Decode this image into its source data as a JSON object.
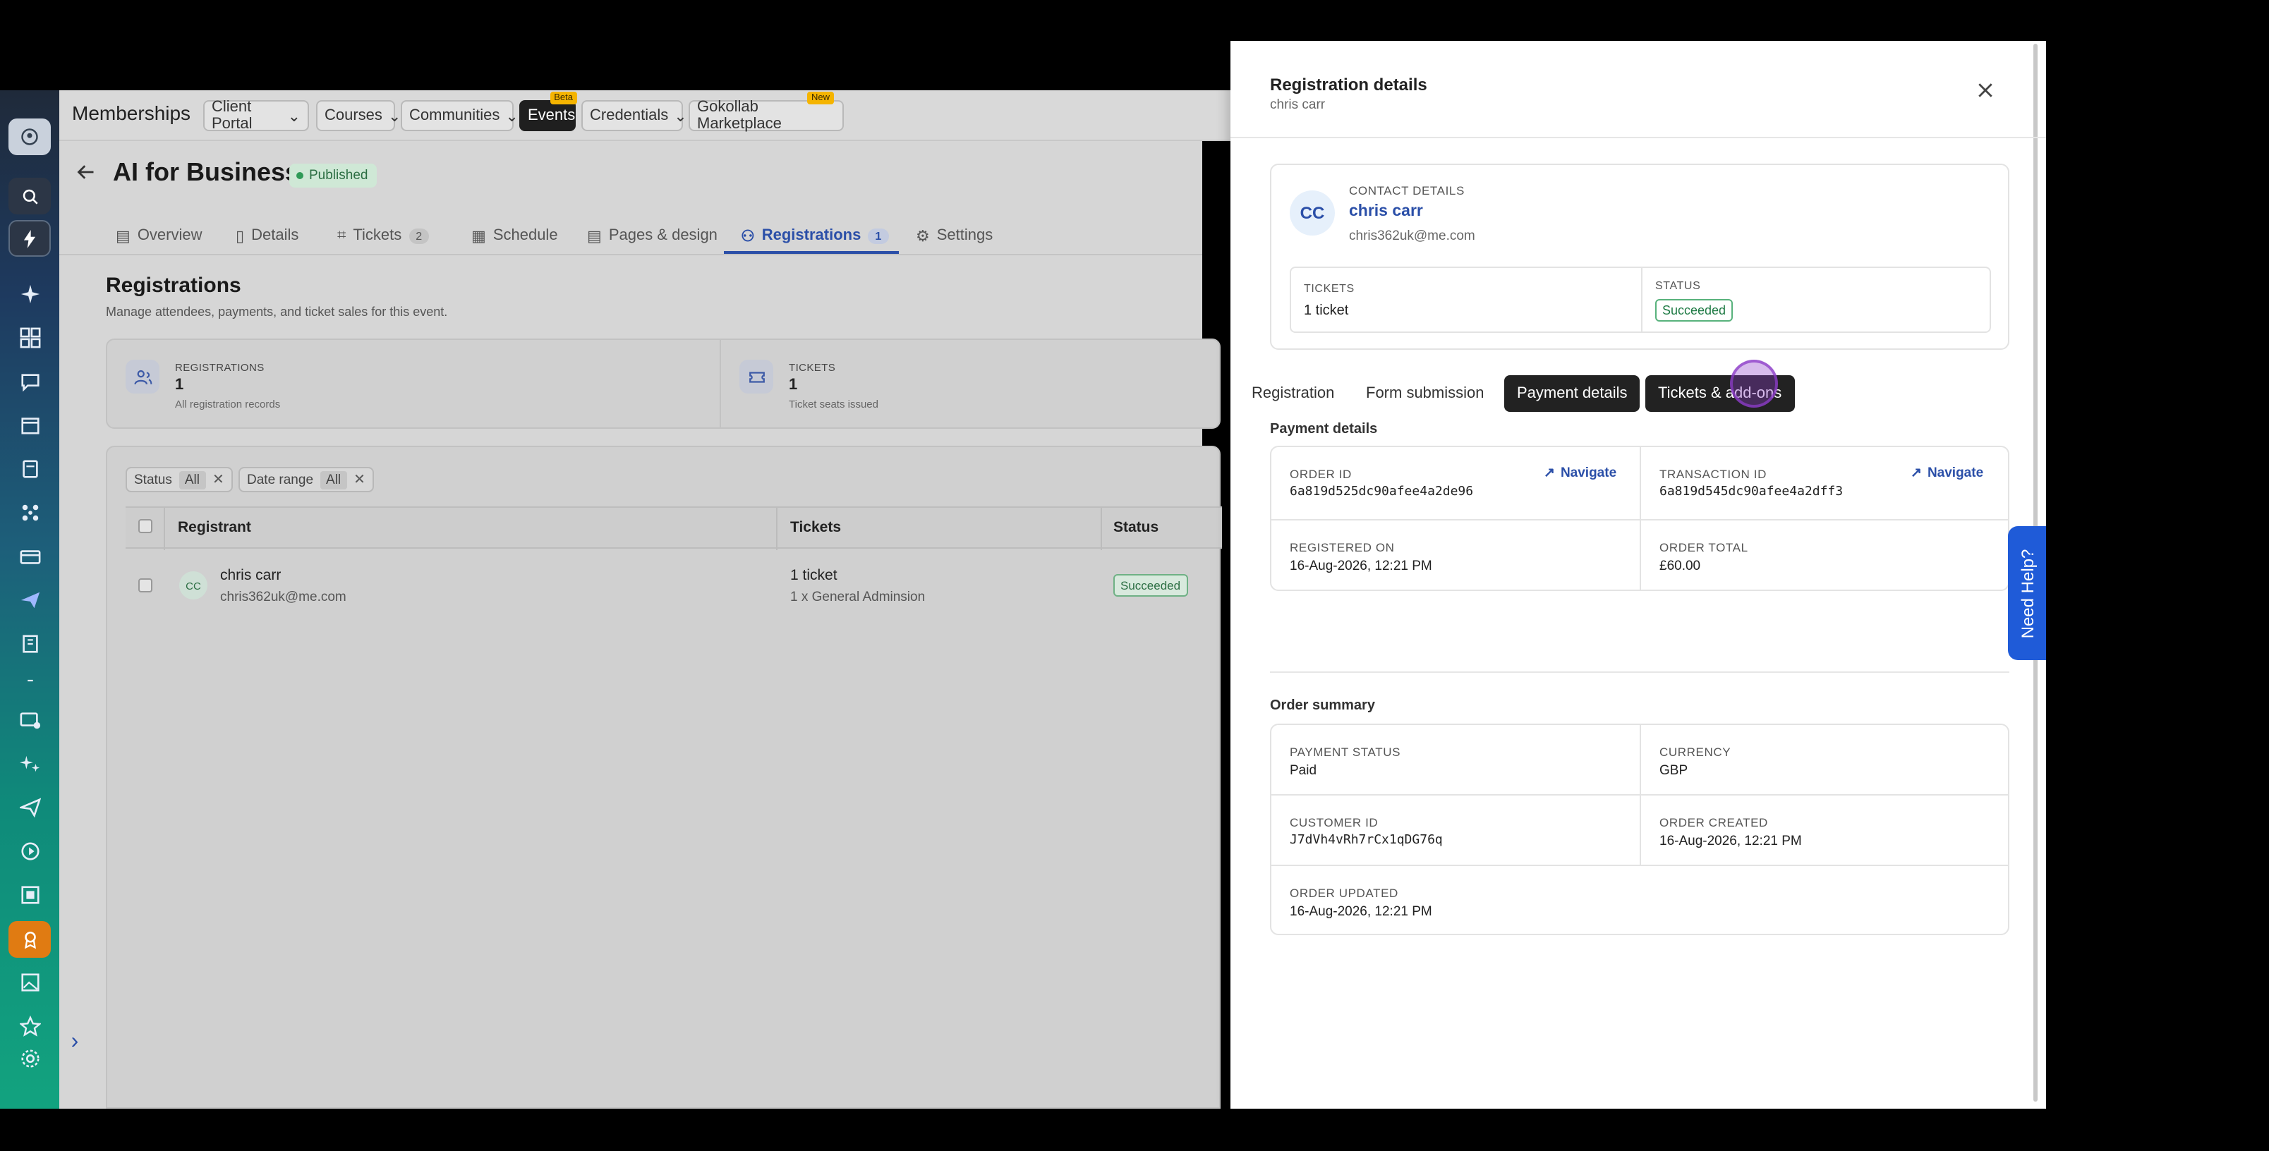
{
  "topnav": {
    "title": "Memberships",
    "items": [
      {
        "label": "Client Portal",
        "chevron": true
      },
      {
        "label": "Courses",
        "chevron": true
      },
      {
        "label": "Communities",
        "chevron": true
      },
      {
        "label": "Events",
        "badge": "Beta",
        "active": true
      },
      {
        "label": "Credentials",
        "chevron": true
      },
      {
        "label": "Gokollab Marketplace",
        "badge": "New"
      }
    ]
  },
  "event": {
    "title": "AI for Business",
    "status": "Published"
  },
  "tabs": [
    {
      "label": "Overview"
    },
    {
      "label": "Details"
    },
    {
      "label": "Tickets",
      "count": "2"
    },
    {
      "label": "Schedule"
    },
    {
      "label": "Pages & design"
    },
    {
      "label": "Registrations",
      "count": "1",
      "active": true
    },
    {
      "label": "Settings"
    }
  ],
  "registrations": {
    "title": "Registrations",
    "subtitle": "Manage attendees, payments, and ticket sales for this event.",
    "stats": [
      {
        "label": "REGISTRATIONS",
        "value": "1",
        "sub": "All registration records"
      },
      {
        "label": "TICKETS",
        "value": "1",
        "sub": "Ticket seats issued"
      }
    ],
    "filters": [
      {
        "label": "Status",
        "value": "All"
      },
      {
        "label": "Date range",
        "value": "All"
      }
    ],
    "columns": [
      "Registrant",
      "Tickets",
      "Status"
    ],
    "rows": [
      {
        "initials": "CC",
        "name": "chris carr",
        "email": "chris362uk@me.com",
        "tickets": "1 ticket",
        "ticket_detail": "1 x General Adminsion",
        "status": "Succeeded"
      }
    ]
  },
  "panel": {
    "title": "Registration details",
    "subtitle": "chris carr",
    "contact": {
      "label": "CONTACT DETAILS",
      "initials": "CC",
      "name": "chris carr",
      "email": "chris362uk@me.com",
      "tickets_label": "TICKETS",
      "tickets_value": "1 ticket",
      "status_label": "STATUS",
      "status_value": "Succeeded"
    },
    "tabs": [
      {
        "label": "Registration"
      },
      {
        "label": "Form submission"
      },
      {
        "label": "Payment details",
        "active": true
      },
      {
        "label": "Tickets & add-ons"
      }
    ],
    "payment_heading": "Payment details",
    "payment": {
      "order_id_label": "ORDER ID",
      "order_id": "6a819d525dc90afee4a2de96",
      "transaction_id_label": "TRANSACTION ID",
      "transaction_id": "6a819d545dc90afee4a2dff3",
      "navigate_label": "Navigate",
      "registered_on_label": "REGISTERED ON",
      "registered_on": "16-Aug-2026, 12:21 PM",
      "order_total_label": "ORDER TOTAL",
      "order_total": "£60.00"
    },
    "summary_heading": "Order summary",
    "summary": {
      "payment_status_label": "PAYMENT STATUS",
      "payment_status": "Paid",
      "currency_label": "CURRENCY",
      "currency": "GBP",
      "customer_id_label": "CUSTOMER ID",
      "customer_id": "J7dVh4vRh7rCx1qDG76q",
      "order_created_label": "ORDER CREATED",
      "order_created": "16-Aug-2026, 12:21 PM",
      "order_updated_label": "ORDER UPDATED",
      "order_updated": "16-Aug-2026, 12:21 PM"
    }
  },
  "help": {
    "label": "Need Help?"
  },
  "colors": {
    "accent": "#2b4fa8",
    "success": "#1e7a44",
    "help": "#1f5bd8",
    "dark_tab": "#222222"
  }
}
